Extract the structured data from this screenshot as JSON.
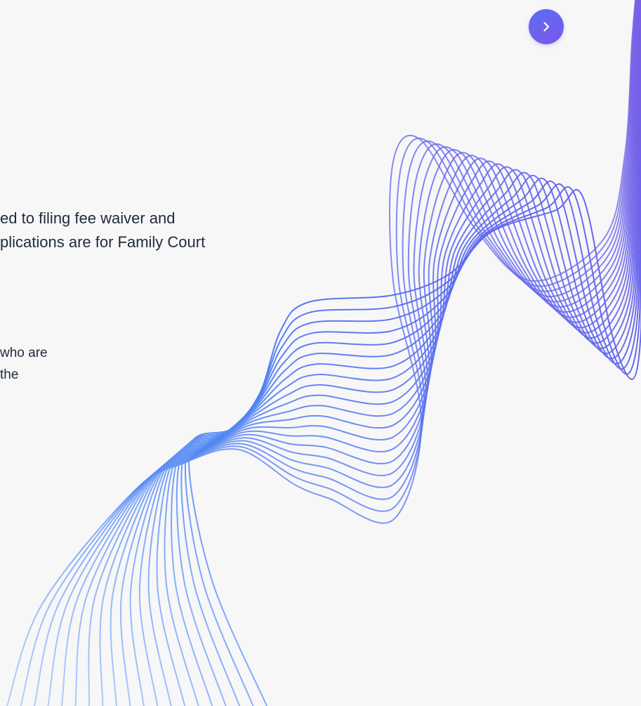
{
  "content": {
    "paragraph_1": {
      "line_1": "ed to filing fee waiver and",
      "line_2": "plications are for Family Court"
    },
    "paragraph_2": {
      "line_1": "who are",
      "line_2": "the"
    }
  },
  "controls": {
    "next_button_icon": "chevron-right-icon"
  },
  "decoration": {
    "wave_icon": "wave-lines-graphic",
    "colors": {
      "wave_start": "#4f7df2",
      "wave_mid": "#5b6cf0",
      "wave_end": "#7a5ee6",
      "button": "#6863ee",
      "text": "#1f2a3a",
      "background": "#f7f7f8"
    }
  }
}
